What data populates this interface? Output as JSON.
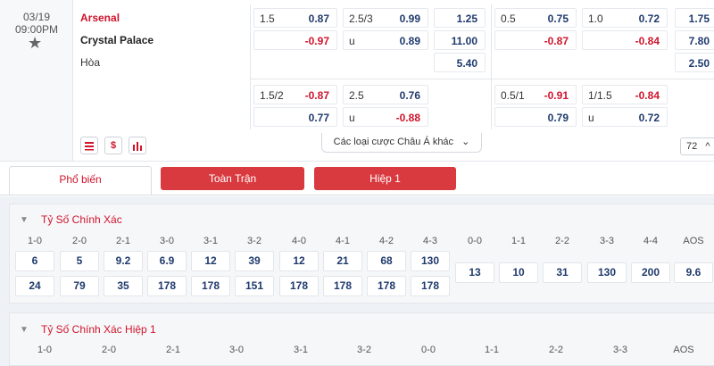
{
  "match": {
    "date": "03/19",
    "time": "09:00PM",
    "home": "Arsenal",
    "away": "Crystal Palace",
    "draw": "Hòa"
  },
  "odds": {
    "r1": {
      "c1h": "1.5",
      "c1o": "0.87",
      "c2h": "2.5/3",
      "c2o": "0.99",
      "c3": "1.25",
      "c4h": "0.5",
      "c4o": "0.75",
      "c5h": "1.0",
      "c5o": "0.72",
      "c6": "1.75"
    },
    "r2": {
      "c1o": "-0.97",
      "c2h": "u",
      "c2o": "0.89",
      "c3": "11.00",
      "c4o": "-0.87",
      "c5o": "-0.84",
      "c6": "7.80"
    },
    "r3": {
      "c3": "5.40",
      "c6": "2.50"
    },
    "r4": {
      "c1h": "1.5/2",
      "c1o": "-0.87",
      "c2h": "2.5",
      "c2o": "0.76",
      "c4h": "0.5/1",
      "c4o": "-0.91",
      "c5h": "1/1.5",
      "c5o": "-0.84"
    },
    "r5": {
      "c1o": "0.77",
      "c2h": "u",
      "c2o": "-0.88",
      "c4o": "0.79",
      "c5h": "u",
      "c5o": "0.72"
    }
  },
  "controls": {
    "more_markets": "Các loại cược Châu Á khác",
    "count": "72"
  },
  "icons": {
    "list": "list-icon",
    "dollar": "$",
    "chart": "bar-chart-icon"
  },
  "tabs": {
    "popular": "Phổ biến",
    "full": "Toàn Trận",
    "half": "Hiệp 1"
  },
  "section1": {
    "title": "Tỷ Số Chính Xác",
    "headers": [
      "1-0",
      "2-0",
      "2-1",
      "3-0",
      "3-1",
      "3-2",
      "4-0",
      "4-1",
      "4-2",
      "4-3",
      "0-0",
      "1-1",
      "2-2",
      "3-3",
      "4-4",
      "AOS"
    ],
    "home_row": [
      "6",
      "5",
      "9.2",
      "6.9",
      "12",
      "39",
      "12",
      "21",
      "68",
      "130"
    ],
    "away_row": [
      "24",
      "79",
      "35",
      "178",
      "178",
      "151",
      "178",
      "178",
      "178",
      "178"
    ],
    "draw_row": [
      "13",
      "10",
      "31",
      "130",
      "200",
      "9.6"
    ]
  },
  "section2": {
    "title": "Tỷ Số Chính Xác Hiệp 1",
    "headers": [
      "1-0",
      "2-0",
      "2-1",
      "3-0",
      "3-1",
      "3-2",
      "0-0",
      "1-1",
      "2-2",
      "3-3",
      "AOS"
    ]
  },
  "colors": {
    "accent": "#d0142c",
    "odds_blue": "#1f3a6d",
    "tab_red": "#d83a3f"
  }
}
